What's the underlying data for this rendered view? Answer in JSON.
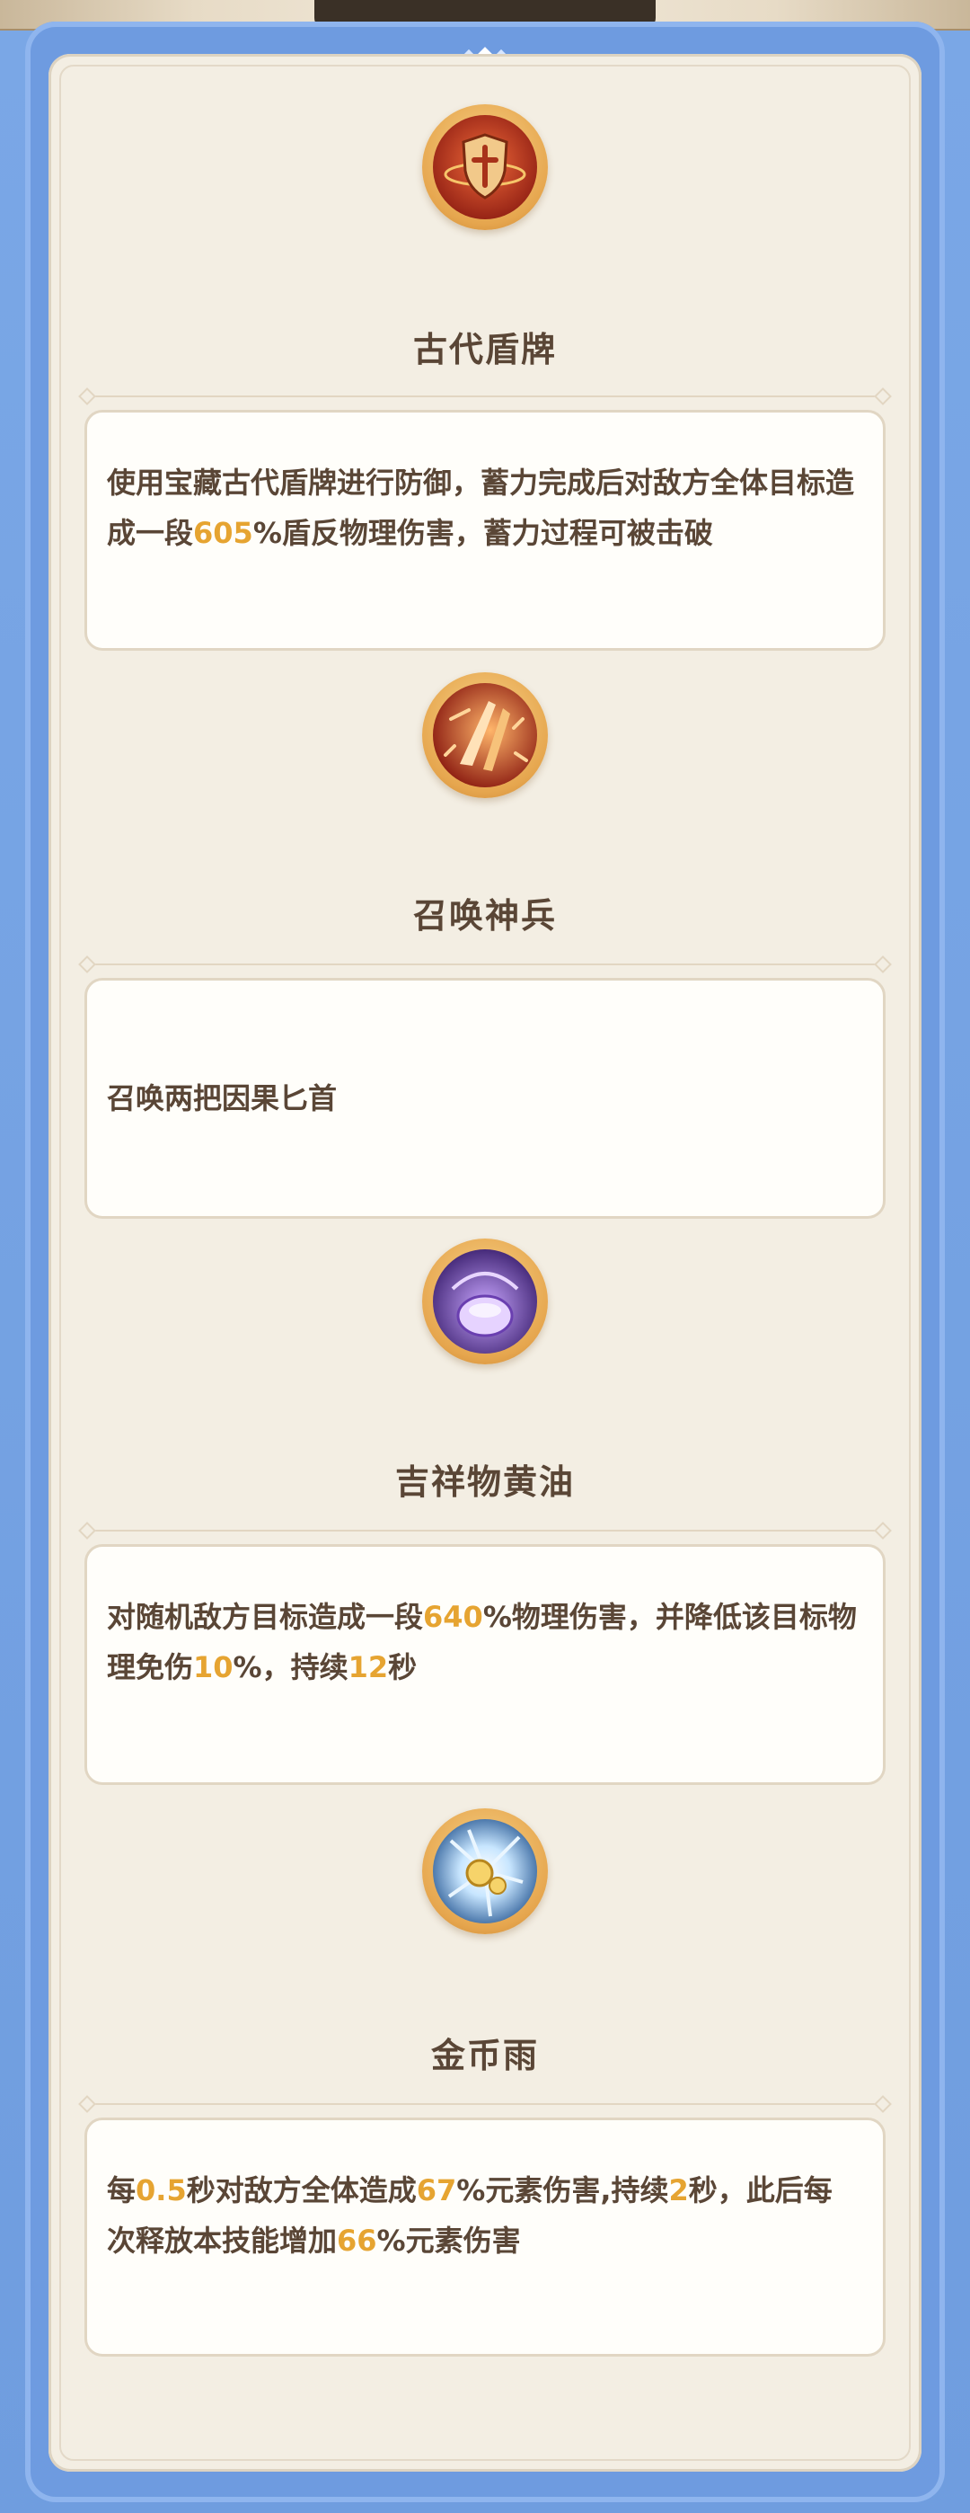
{
  "skills": [
    {
      "name": "古代盾牌",
      "icon": "shield-icon",
      "description": [
        {
          "t": "使用宝藏古代盾牌进行防御，蓄力完成后对敌方全体目标造成一段"
        },
        {
          "t": "605",
          "hl": true
        },
        {
          "t": "%盾反物理伤害，蓄力过程可被击破"
        }
      ]
    },
    {
      "name": "召唤神兵",
      "icon": "blades-icon",
      "description": [
        {
          "t": "召唤两把因果匕首"
        }
      ]
    },
    {
      "name": "吉祥物黄油",
      "icon": "mascot-icon",
      "description": [
        {
          "t": "对随机敌方目标造成一段"
        },
        {
          "t": "640",
          "hl": true
        },
        {
          "t": "%物理伤害，并降低该目标物理免伤"
        },
        {
          "t": "10",
          "hl": true
        },
        {
          "t": "%，持续"
        },
        {
          "t": "12",
          "hl": true
        },
        {
          "t": "秒"
        }
      ]
    },
    {
      "name": "金币雨",
      "icon": "coin-rain-icon",
      "description": [
        {
          "t": "每"
        },
        {
          "t": "0.5",
          "hl": true
        },
        {
          "t": "秒对敌方全体造成"
        },
        {
          "t": "67",
          "hl": true
        },
        {
          "t": "%元素伤害,持续"
        },
        {
          "t": "2",
          "hl": true
        },
        {
          "t": "秒，此后每次释放本技能增加"
        },
        {
          "t": "66",
          "hl": true
        },
        {
          "t": "%元素伤害"
        }
      ]
    }
  ],
  "colors": {
    "highlight": "#e6a431",
    "text": "#5a4636",
    "frame": "#6e9be0",
    "panel": "#f3eee3"
  }
}
